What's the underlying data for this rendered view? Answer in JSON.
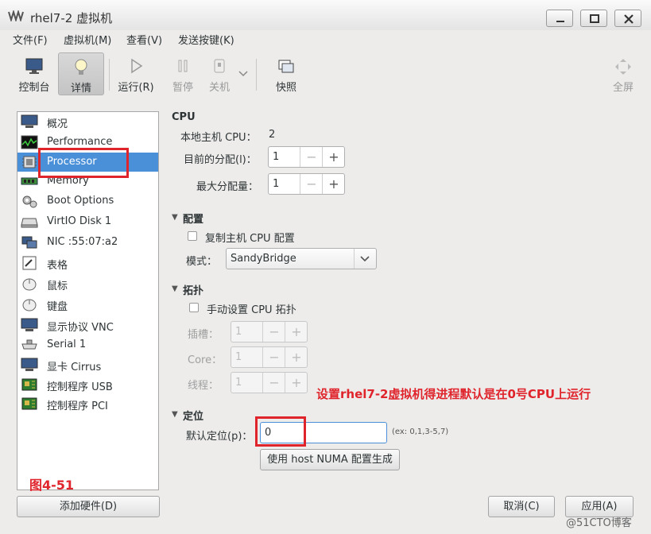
{
  "window": {
    "title": "rhel7-2 虚拟机"
  },
  "menu": [
    "文件(F)",
    "虚拟机(M)",
    "查看(V)",
    "发送按键(K)"
  ],
  "toolbar": {
    "console": "控制台",
    "details": "详情",
    "run": "运行(R)",
    "pause": "暂停",
    "shutdown": "关机",
    "snapshot": "快照",
    "fullscreen": "全屏"
  },
  "sidebar": {
    "items": [
      {
        "label": "概况",
        "icon": "monitor-icon"
      },
      {
        "label": "Performance",
        "icon": "performance-graph-icon"
      },
      {
        "label": "Processor",
        "icon": "cpu-chip-icon"
      },
      {
        "label": "Memory",
        "icon": "memory-module-icon"
      },
      {
        "label": "Boot Options",
        "icon": "gears-icon"
      },
      {
        "label": "VirtIO Disk 1",
        "icon": "hard-disk-icon"
      },
      {
        "label": "NIC :55:07:a2",
        "icon": "network-card-icon"
      },
      {
        "label": "表格",
        "icon": "tablet-icon"
      },
      {
        "label": "鼠标",
        "icon": "mouse-icon"
      },
      {
        "label": "键盘",
        "icon": "keyboard-icon"
      },
      {
        "label": "显示协议 VNC",
        "icon": "display-monitor-icon"
      },
      {
        "label": "Serial 1",
        "icon": "serial-port-icon"
      },
      {
        "label": "显卡 Cirrus",
        "icon": "video-card-icon"
      },
      {
        "label": "控制程序 USB",
        "icon": "controller-board-icon"
      },
      {
        "label": "控制程序 PCI",
        "icon": "controller-board-icon"
      }
    ],
    "selected": "Processor",
    "add_hardware": "添加硬件(D)",
    "figure_label": "图4-51"
  },
  "cpu": {
    "heading": "CPU",
    "host_cpus_label": "本地主机 CPU：",
    "host_cpus_value": "2",
    "current_alloc_label": "目前的分配(l)：",
    "current_alloc_value": "1",
    "max_alloc_label": "最大分配量：",
    "max_alloc_value": "1"
  },
  "config": {
    "heading": "配置",
    "copy_host_label": "复制主机 CPU 配置",
    "model_label": "模式：",
    "model_value": "SandyBridge"
  },
  "topology": {
    "heading": "拓扑",
    "manual_label": "手动设置 CPU 拓扑",
    "sockets_label": "插槽：",
    "sockets_value": "1",
    "cores_label": "Core：",
    "cores_value": "1",
    "threads_label": "线程：",
    "threads_value": "1"
  },
  "pinning": {
    "heading": "定位",
    "default_label": "默认定位(p)：",
    "default_value": "0",
    "example": "(ex: 0,1,3-5,7)",
    "numa_button": "使用 host NUMA 配置生成"
  },
  "annotation": "设置rhel7-2虚拟机得进程默认是在0号CPU上运行",
  "footer": {
    "cancel": "取消(C)",
    "apply": "应用(A)"
  },
  "watermark": "@51CTO博客"
}
